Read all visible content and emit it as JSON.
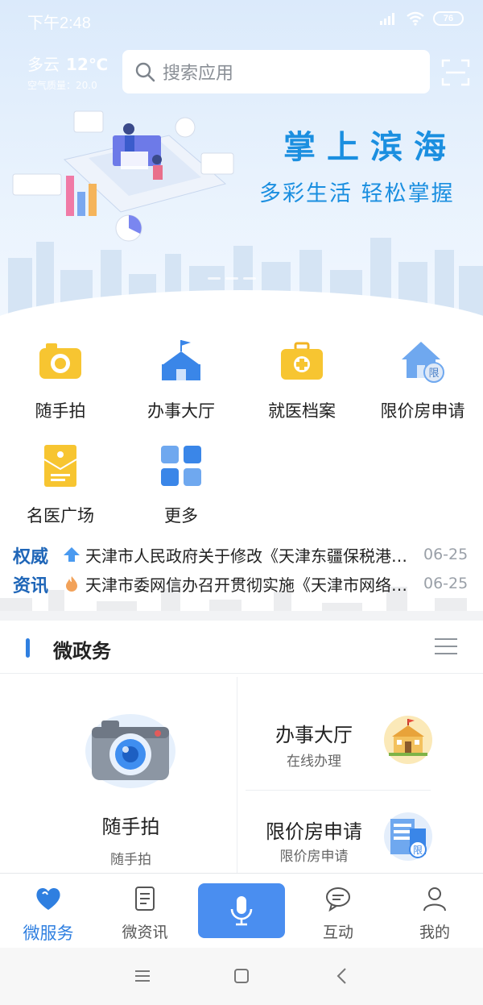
{
  "status_bar": {
    "time": "下午2:48",
    "battery": "76"
  },
  "header": {
    "weather": "多云",
    "temperature": "12℃",
    "air_quality": "空气质量：20.0",
    "search_placeholder": "搜索应用"
  },
  "banner": {
    "title": "掌上滨海",
    "subtitle": "多彩生活  轻松掌握"
  },
  "services": [
    {
      "label": "随手拍",
      "icon": "camera-icon"
    },
    {
      "label": "办事大厅",
      "icon": "hall-icon"
    },
    {
      "label": "就医档案",
      "icon": "medical-kit-icon"
    },
    {
      "label": "限价房申请",
      "icon": "house-limit-icon"
    },
    {
      "label": "名医广场",
      "icon": "doctor-document-icon"
    },
    {
      "label": "更多",
      "icon": "more-grid-icon"
    }
  ],
  "news": {
    "tag": "权威资讯",
    "items": [
      {
        "title": "天津市人民政府关于修改《天津东疆保税港区管理规定》的决定",
        "date": "06-25",
        "icon": "arrow-up-icon"
      },
      {
        "title": "天津市委网信办召开贯彻实施《天津市网络安全条例》工作会议",
        "date": "06-25",
        "icon": "fire-icon"
      }
    ]
  },
  "section": {
    "title": "微政务"
  },
  "cards": {
    "left": {
      "title": "随手拍",
      "subtitle": "随手拍"
    },
    "right": [
      {
        "title": "办事大厅",
        "subtitle": "在线办理"
      },
      {
        "title": "限价房申请",
        "subtitle": "限价房申请"
      }
    ]
  },
  "tabbar": [
    {
      "label": "微服务",
      "icon": "heart-icon",
      "active": true
    },
    {
      "label": "微资讯",
      "icon": "document-icon",
      "active": false
    },
    {
      "label": "",
      "icon": "microphone-icon",
      "active": false
    },
    {
      "label": "互动",
      "icon": "chat-icon",
      "active": false
    },
    {
      "label": "我的",
      "icon": "person-icon",
      "active": false
    }
  ],
  "colors": {
    "accent": "#2f7fe0",
    "banner_text": "#1b8fe0",
    "news_tag": "#1f66b8"
  }
}
